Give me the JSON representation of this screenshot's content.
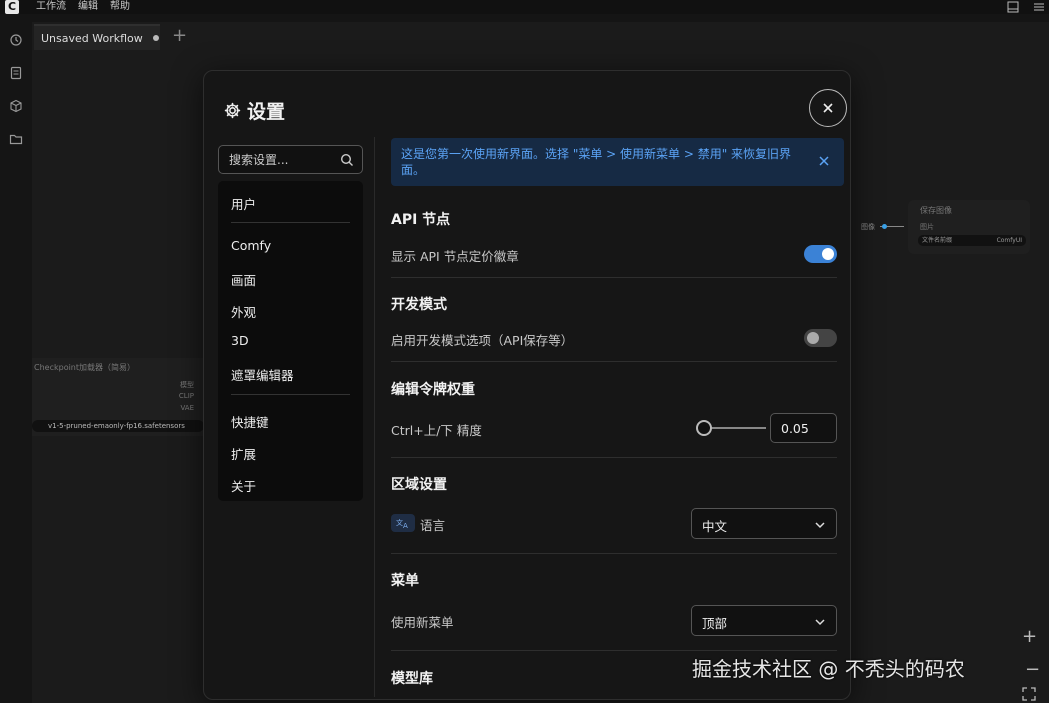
{
  "menubar": {
    "items": [
      "工作流",
      "编辑",
      "帮助"
    ]
  },
  "tab": {
    "label": "Unsaved Workflow"
  },
  "canvas_nodes": {
    "checkpoint_title": "Checkpoint加载器（简易）",
    "checkpoint_outputs": [
      "模型",
      "CLIP",
      "VAE"
    ],
    "checkpoint_value": "v1-5-pruned-emaonly-fp16.safetensors",
    "save_title": "保存图像",
    "save_input": "图片",
    "save_widget_label": "文件名前缀",
    "save_widget_value": "ComfyUI",
    "left_label": "图像"
  },
  "dialog": {
    "title": "设置",
    "search_placeholder": "搜索设置...",
    "nav": {
      "group1": [
        "用户"
      ],
      "group2": [
        "Comfy",
        "画面",
        "外观",
        "3D",
        "遮罩编辑器"
      ],
      "group3": [
        "快捷键",
        "扩展",
        "关于"
      ]
    },
    "banner": "这是您第一次使用新界面。选择 \"菜单 > 使用新菜单 > 禁用\" 来恢复旧界面。",
    "sections": {
      "api": {
        "title": "API 节点",
        "setting": "显示 API 节点定价徽章",
        "enabled": true
      },
      "dev": {
        "title": "开发模式",
        "setting": "启用开发模式选项（API保存等）",
        "enabled": false
      },
      "token": {
        "title": "编辑令牌权重",
        "setting": "Ctrl+上/下 精度",
        "value": "0.05"
      },
      "locale": {
        "title": "区域设置",
        "setting": "语言",
        "value": "中文"
      },
      "menu": {
        "title": "菜单",
        "setting": "使用新菜单",
        "value": "顶部"
      },
      "next": {
        "title": "模型库"
      }
    }
  },
  "watermark": "掘金技术社区 @ 不秃头的码农",
  "colors": {
    "accent": "#3b82d6",
    "banner_bg": "#162a44",
    "banner_text": "#5ba3f5"
  }
}
